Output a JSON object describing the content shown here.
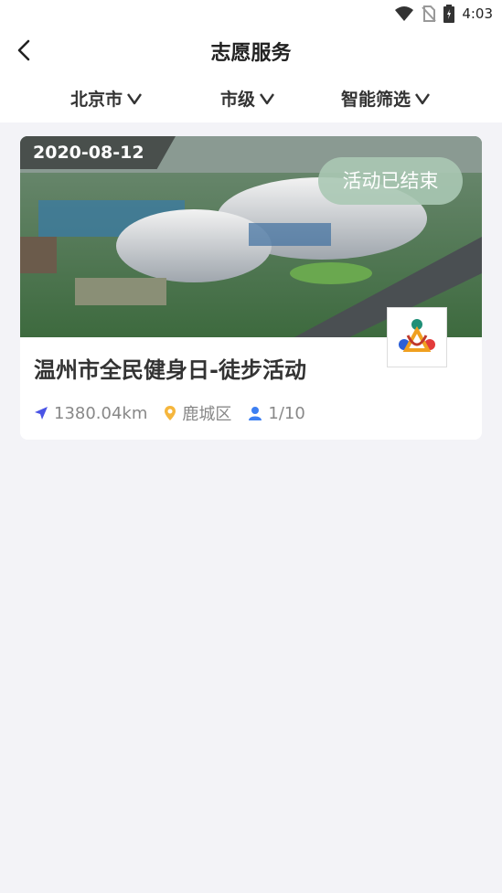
{
  "status_bar": {
    "time": "4:03"
  },
  "header": {
    "title": "志愿服务"
  },
  "filters": [
    {
      "label": "北京市"
    },
    {
      "label": "市级"
    },
    {
      "label": "智能筛选"
    }
  ],
  "activity": {
    "date": "2020-08-12",
    "status": "活动已结束",
    "title": "温州市全民健身日-徒步活动",
    "distance": "1380.04km",
    "district": "鹿城区",
    "participants": "1/10"
  },
  "colors": {
    "accent": "#4a54e6",
    "location": "#f5b63d",
    "person": "#3d7ff2",
    "status_pill": "#a9c8b4"
  },
  "icons": {
    "wifi": "wifi-icon",
    "no_sim": "no-sim-icon",
    "battery": "battery-icon",
    "back": "back-arrow-icon",
    "chevron": "chevron-down-icon",
    "navigation": "navigation-arrow-icon",
    "location": "location-pin-icon",
    "person": "person-icon"
  }
}
